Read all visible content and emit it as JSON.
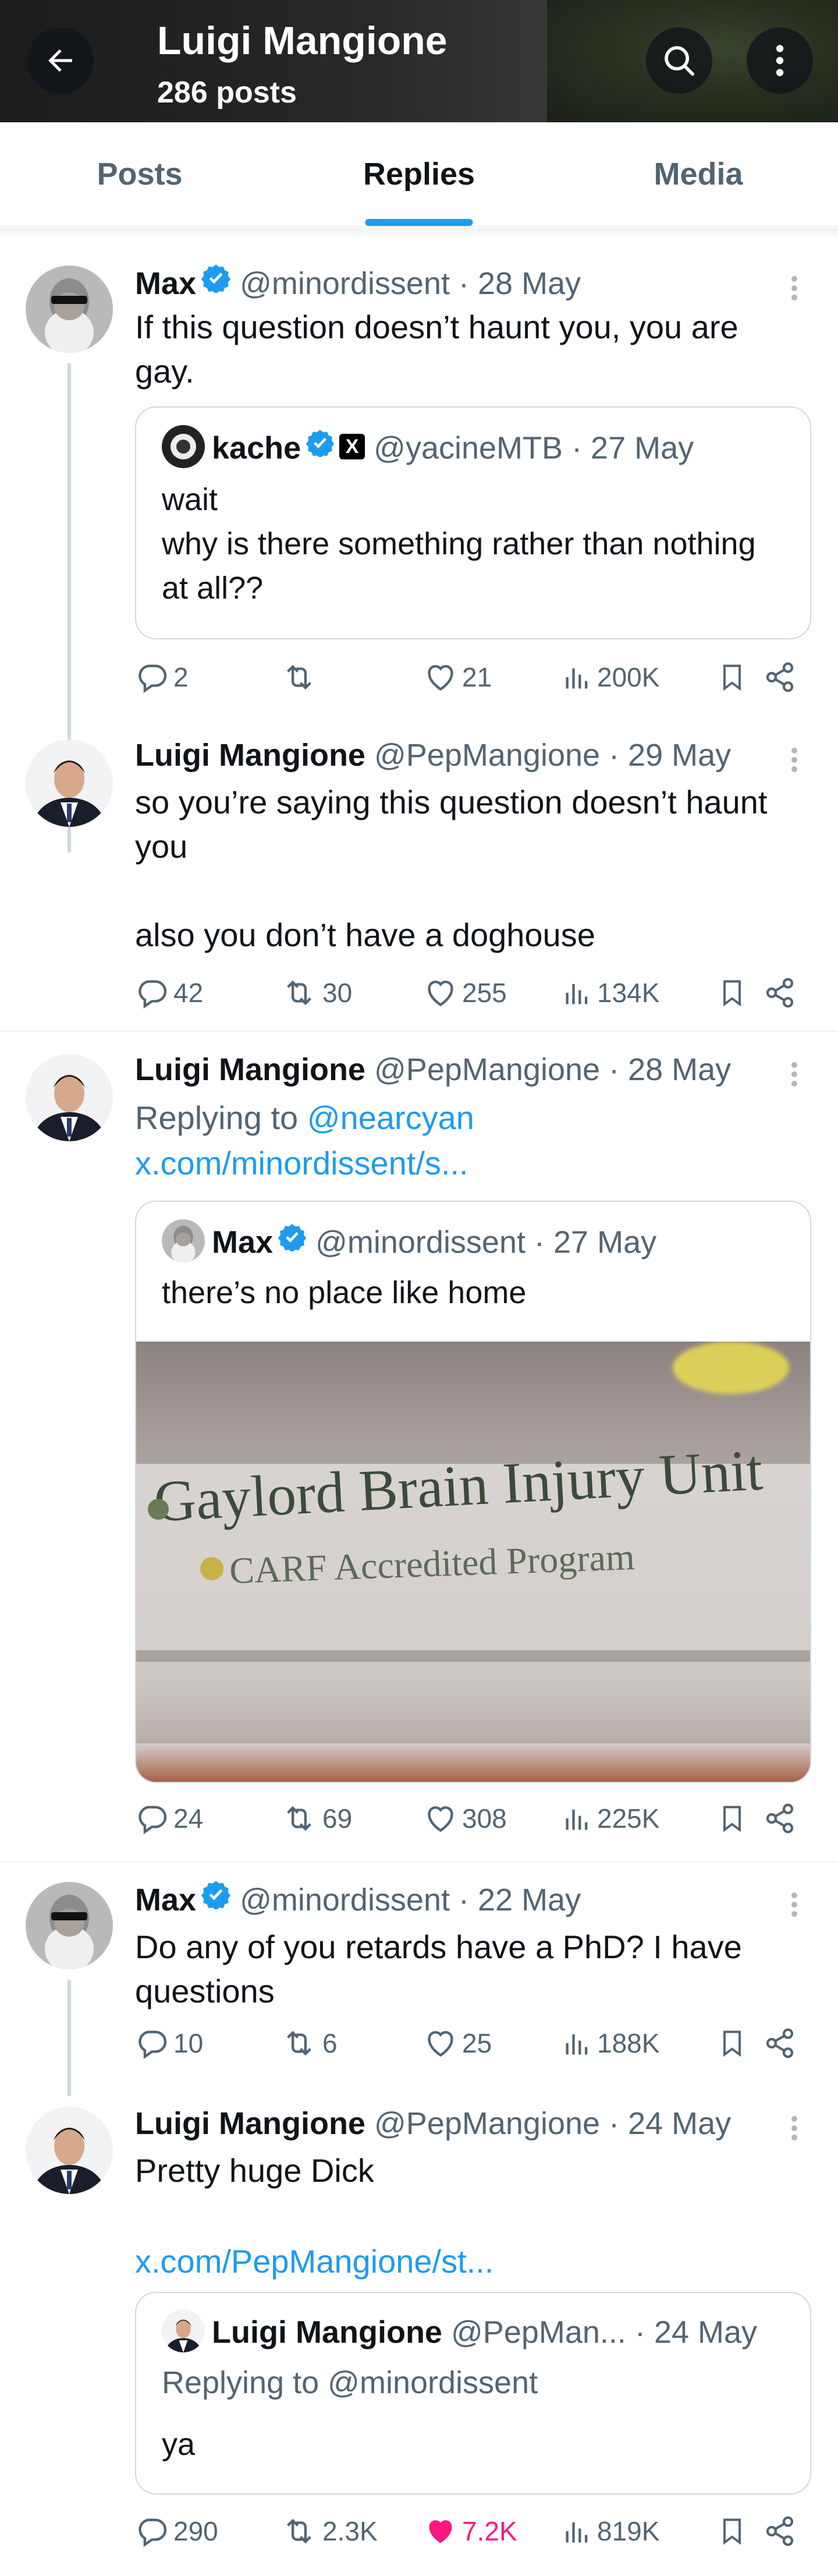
{
  "header": {
    "title": "Luigi Mangione",
    "subtitle": "286 posts"
  },
  "tabs": [
    {
      "label": "Posts",
      "active": false
    },
    {
      "label": "Replies",
      "active": true
    },
    {
      "label": "Media",
      "active": false
    }
  ],
  "colors": {
    "accent": "#1d9bf0",
    "like": "#f91880",
    "verified": "#1d9bf0"
  },
  "posts": [
    {
      "name": "Max",
      "handle": "@minordissent",
      "date": "· 28 May",
      "text": "If this question doesn’t haunt you, you are gay.",
      "quote": {
        "name": "kache",
        "handle": "@yacineMTB",
        "date": "· 27 May",
        "text": "wait\nwhy is there something rather than nothing at all??"
      },
      "stats": {
        "replies": "2",
        "reposts": "",
        "likes": "21",
        "views": "200K"
      }
    },
    {
      "name": "Luigi Mangione",
      "handle": "@PepMangione",
      "date": "· 29 May",
      "text": "so you’re saying this question doesn’t haunt you\n\nalso you don’t have a doghouse",
      "stats": {
        "replies": "42",
        "reposts": "30",
        "likes": "255",
        "views": "134K"
      }
    },
    {
      "name": "Luigi Mangione",
      "handle": "@PepMangione",
      "date": "· 28 May",
      "replying_prefix": "Replying to ",
      "replying_to": "@nearcyan",
      "link": "x.com/minordissent/s...",
      "quote": {
        "name": "Max",
        "handle": "@minordissent",
        "date": "· 27 May",
        "text": "there’s no place like home",
        "image_sign": {
          "line1": "Gaylord Brain Injury Unit",
          "line2": "CARF Accredited Program"
        }
      },
      "stats": {
        "replies": "24",
        "reposts": "69",
        "likes": "308",
        "views": "225K"
      }
    },
    {
      "name": "Max",
      "handle": "@minordissent",
      "date": "· 22 May",
      "text": "Do any of you retards have a PhD? I have questions",
      "stats": {
        "replies": "10",
        "reposts": "6",
        "likes": "25",
        "views": "188K"
      }
    },
    {
      "name": "Luigi Mangione",
      "handle": "@PepMangione",
      "date": "· 24 May",
      "text": "Pretty huge Dick",
      "link": "x.com/PepMangione/st...",
      "quote": {
        "name": "Luigi Mangione",
        "handle": "@PepMan...",
        "date": "· 24 May",
        "replying": "Replying to @minordissent",
        "text": "ya"
      },
      "stats": {
        "replies": "290",
        "reposts": "2.3K",
        "likes": "7.2K",
        "views": "819K",
        "liked": true
      }
    }
  ]
}
